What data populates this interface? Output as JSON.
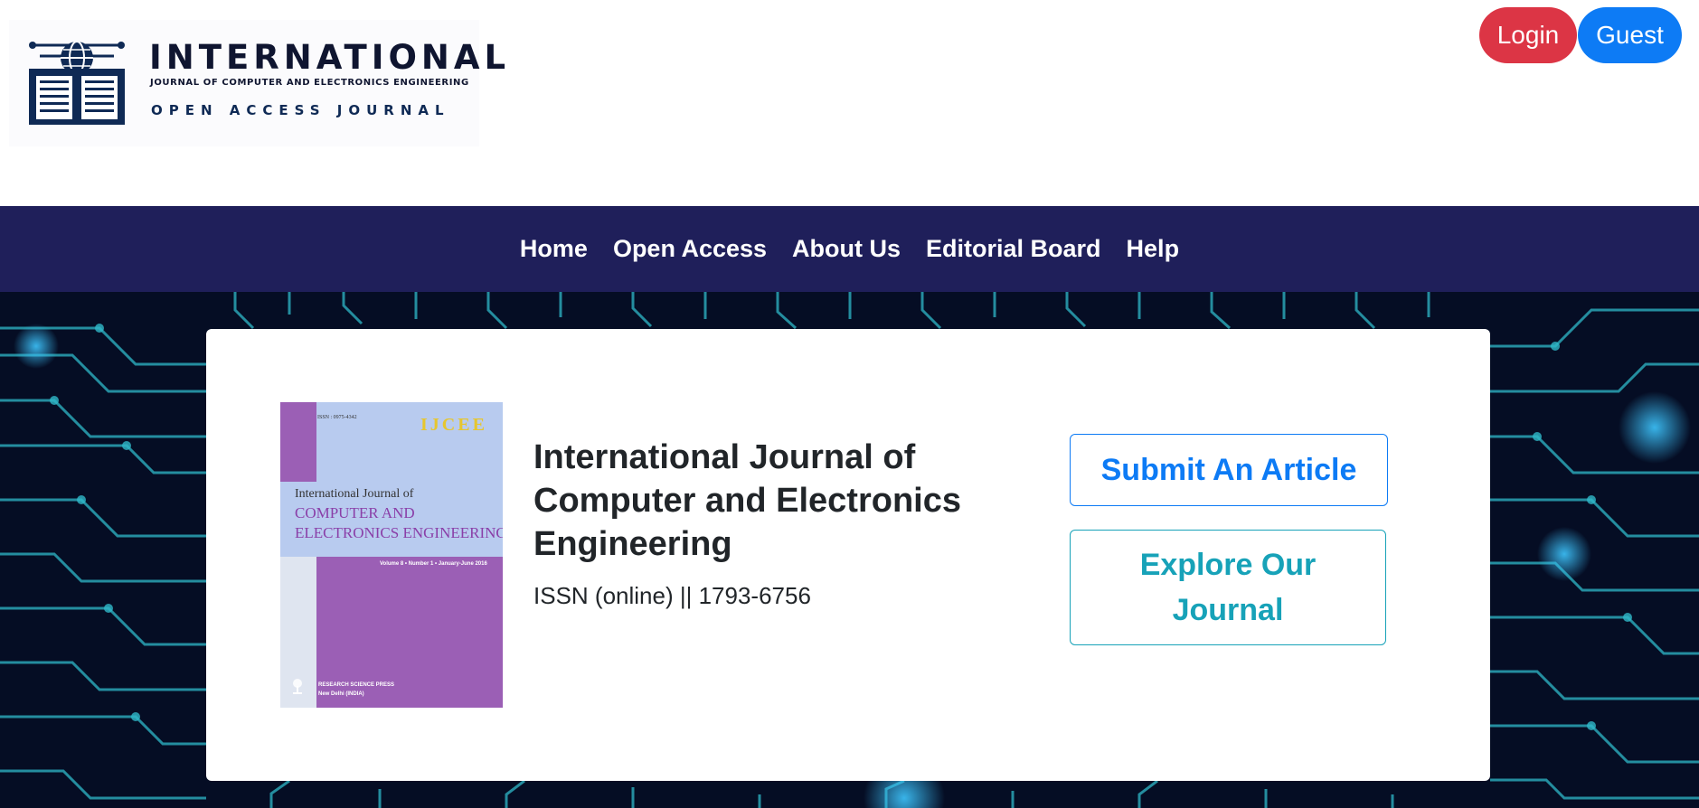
{
  "logo": {
    "title": "INTERNATIONAL",
    "subtitle": "JOURNAL OF COMPUTER AND ELECTRONICS ENGINEERING",
    "tagline": "OPEN ACCESS JOURNAL"
  },
  "auth": {
    "login_label": "Login",
    "guest_label": "Guest"
  },
  "nav": {
    "items": [
      "Home",
      "Open Access",
      "About Us",
      "Editorial Board",
      "Help"
    ]
  },
  "cover": {
    "issn": "ISSN : 0975-4342",
    "abbr": "IJCEE",
    "line1": "International Journal of",
    "line2": "COMPUTER AND",
    "line3": "ELECTRONICS ENGINEERING",
    "volume": "Volume 8 • Number 1 • January-June 2016",
    "publisher": "RESEARCH SCIENCE PRESS",
    "city": "New Delhi (INDIA)"
  },
  "journal": {
    "title": "International Journal of Computer and Electronics Engineering",
    "issn": "ISSN (online) || 1793-6756"
  },
  "actions": {
    "submit_label": "Submit An Article",
    "explore_label": "Explore Our Journal"
  },
  "colors": {
    "nav_bg": "#1f1f5a",
    "login": "#dc3545",
    "guest": "#0d7bf5",
    "submit": "#0d7bf5",
    "explore": "#17a2b8",
    "hero_bg": "#050d24",
    "circuit": "#2fb8c8"
  }
}
